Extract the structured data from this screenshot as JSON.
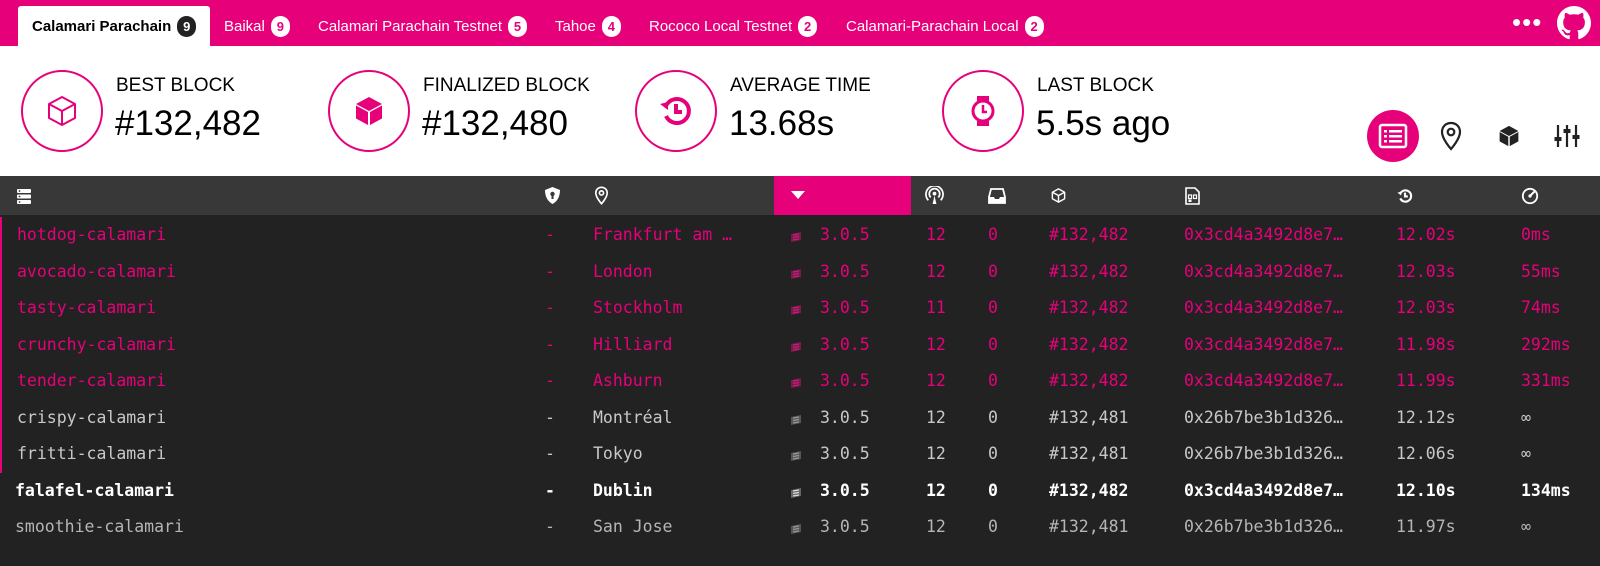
{
  "tabs": [
    {
      "label": "Calamari Parachain",
      "count": "9",
      "active": true
    },
    {
      "label": "Baikal",
      "count": "9"
    },
    {
      "label": "Calamari Parachain Testnet",
      "count": "5"
    },
    {
      "label": "Tahoe",
      "count": "4"
    },
    {
      "label": "Rococo Local Testnet",
      "count": "2"
    },
    {
      "label": "Calamari-Parachain Local",
      "count": "2"
    }
  ],
  "menu_icon": "more-dots-icon",
  "github_icon": "github-icon",
  "stats": {
    "best_block": {
      "label": "BEST BLOCK",
      "value": "#132,482",
      "icon": "cube-outline-icon"
    },
    "finalized_block": {
      "label": "FINALIZED BLOCK",
      "value": "#132,480",
      "icon": "cube-solid-icon"
    },
    "average_time": {
      "label": "AVERAGE TIME",
      "value": "13.68s",
      "icon": "timer-icon"
    },
    "last_block": {
      "label": "LAST BLOCK",
      "value": "5.5s ago",
      "icon": "watch-icon"
    }
  },
  "view_buttons": [
    {
      "name": "list-view-icon",
      "active": true
    },
    {
      "name": "map-view-icon"
    },
    {
      "name": "block-view-icon"
    },
    {
      "name": "settings-icon"
    }
  ],
  "columns": [
    {
      "icon": "server-icon"
    },
    {
      "icon": "validator-shield-icon"
    },
    {
      "icon": "location-pin-icon"
    },
    {
      "icon": "sort-arrow-down-icon",
      "sorted": true
    },
    {
      "icon": "peers-antenna-icon"
    },
    {
      "icon": "transactions-inbox-icon"
    },
    {
      "icon": "block-cube-icon"
    },
    {
      "icon": "block-hash-icon"
    },
    {
      "icon": "block-time-icon"
    },
    {
      "icon": "propagation-gauge-icon"
    }
  ],
  "colors": {
    "accent": "#e6007a",
    "header_bg": "#ffffff",
    "table_bg": "#222222",
    "thead_bg": "#393838"
  },
  "nodes": [
    {
      "name": "hotdog-calamari",
      "validator": "-",
      "location": "Frankfurt am …",
      "version": "3.0.5",
      "peers": "12",
      "txs": "0",
      "block": "#132,482",
      "hash": "0x3cd4a3492d8e7…",
      "time": "12.02s",
      "propagation": "0ms",
      "style": "pink"
    },
    {
      "name": "avocado-calamari",
      "validator": "-",
      "location": "London",
      "version": "3.0.5",
      "peers": "12",
      "txs": "0",
      "block": "#132,482",
      "hash": "0x3cd4a3492d8e7…",
      "time": "12.03s",
      "propagation": "55ms",
      "style": "pink"
    },
    {
      "name": "tasty-calamari",
      "validator": "-",
      "location": "Stockholm",
      "version": "3.0.5",
      "peers": "11",
      "txs": "0",
      "block": "#132,482",
      "hash": "0x3cd4a3492d8e7…",
      "time": "12.03s",
      "propagation": "74ms",
      "style": "pink"
    },
    {
      "name": "crunchy-calamari",
      "validator": "-",
      "location": "Hilliard",
      "version": "3.0.5",
      "peers": "12",
      "txs": "0",
      "block": "#132,482",
      "hash": "0x3cd4a3492d8e7…",
      "time": "11.98s",
      "propagation": "292ms",
      "style": "pink"
    },
    {
      "name": "tender-calamari",
      "validator": "-",
      "location": "Ashburn",
      "version": "3.0.5",
      "peers": "12",
      "txs": "0",
      "block": "#132,482",
      "hash": "0x3cd4a3492d8e7…",
      "time": "11.99s",
      "propagation": "331ms",
      "style": "pink"
    },
    {
      "name": "crispy-calamari",
      "validator": "-",
      "location": "Montréal",
      "version": "3.0.5",
      "peers": "12",
      "txs": "0",
      "block": "#132,481",
      "hash": "0x26b7be3b1d326…",
      "time": "12.12s",
      "propagation": "∞",
      "style": "gray"
    },
    {
      "name": "fritti-calamari",
      "validator": "-",
      "location": "Tokyo",
      "version": "3.0.5",
      "peers": "12",
      "txs": "0",
      "block": "#132,481",
      "hash": "0x26b7be3b1d326…",
      "time": "12.06s",
      "propagation": "∞",
      "style": "gray"
    },
    {
      "name": "falafel-calamari",
      "validator": "-",
      "location": "Dublin",
      "version": "3.0.5",
      "peers": "12",
      "txs": "0",
      "block": "#132,482",
      "hash": "0x3cd4a3492d8e7…",
      "time": "12.10s",
      "propagation": "134ms",
      "style": "white"
    },
    {
      "name": "smoothie-calamari",
      "validator": "-",
      "location": "San Jose",
      "version": "3.0.5",
      "peers": "12",
      "txs": "0",
      "block": "#132,481",
      "hash": "0x26b7be3b1d326…",
      "time": "11.97s",
      "propagation": "∞",
      "style": "dim"
    }
  ]
}
